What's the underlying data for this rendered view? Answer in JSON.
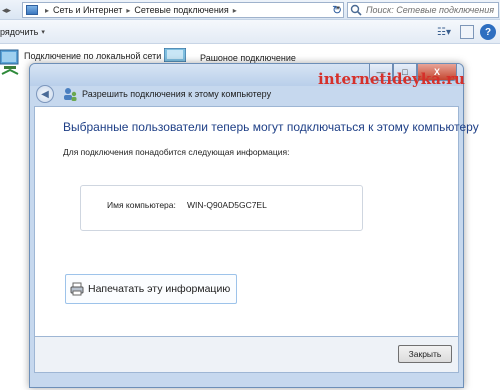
{
  "explorer": {
    "address": {
      "segment_1": "Сеть и Интернет",
      "segment_2": "Сетевые подключения",
      "separator": "▸"
    },
    "search_placeholder": "Поиск: Сетевые подключения",
    "toolbar": {
      "organize_label": "рядочить"
    },
    "connections": [
      {
        "name": "Подключение по локальной сети"
      },
      {
        "name": "Рашоное подключение"
      }
    ]
  },
  "dialog": {
    "title": "Разрешить подключения к этому компьютеру",
    "heading": "Выбранные пользователи теперь могут подключаться к этому компьютеру",
    "subtitle": "Для подключения понадобится следующая информация:",
    "computer_name_label": "Имя компьютера:",
    "computer_name_value": "WIN-Q90AD5GC7EL",
    "print_button_label": "Напечатать эту информацию",
    "close_button_label": "Закрыть",
    "window_controls": {
      "minimize": "—",
      "maximize": "□",
      "close": "X"
    }
  },
  "watermark": "internetideyka.ru",
  "colors": {
    "heading_blue": "#1e3f86",
    "watermark_red": "#d6302a",
    "dialog_frame": "#c6d8ee"
  }
}
